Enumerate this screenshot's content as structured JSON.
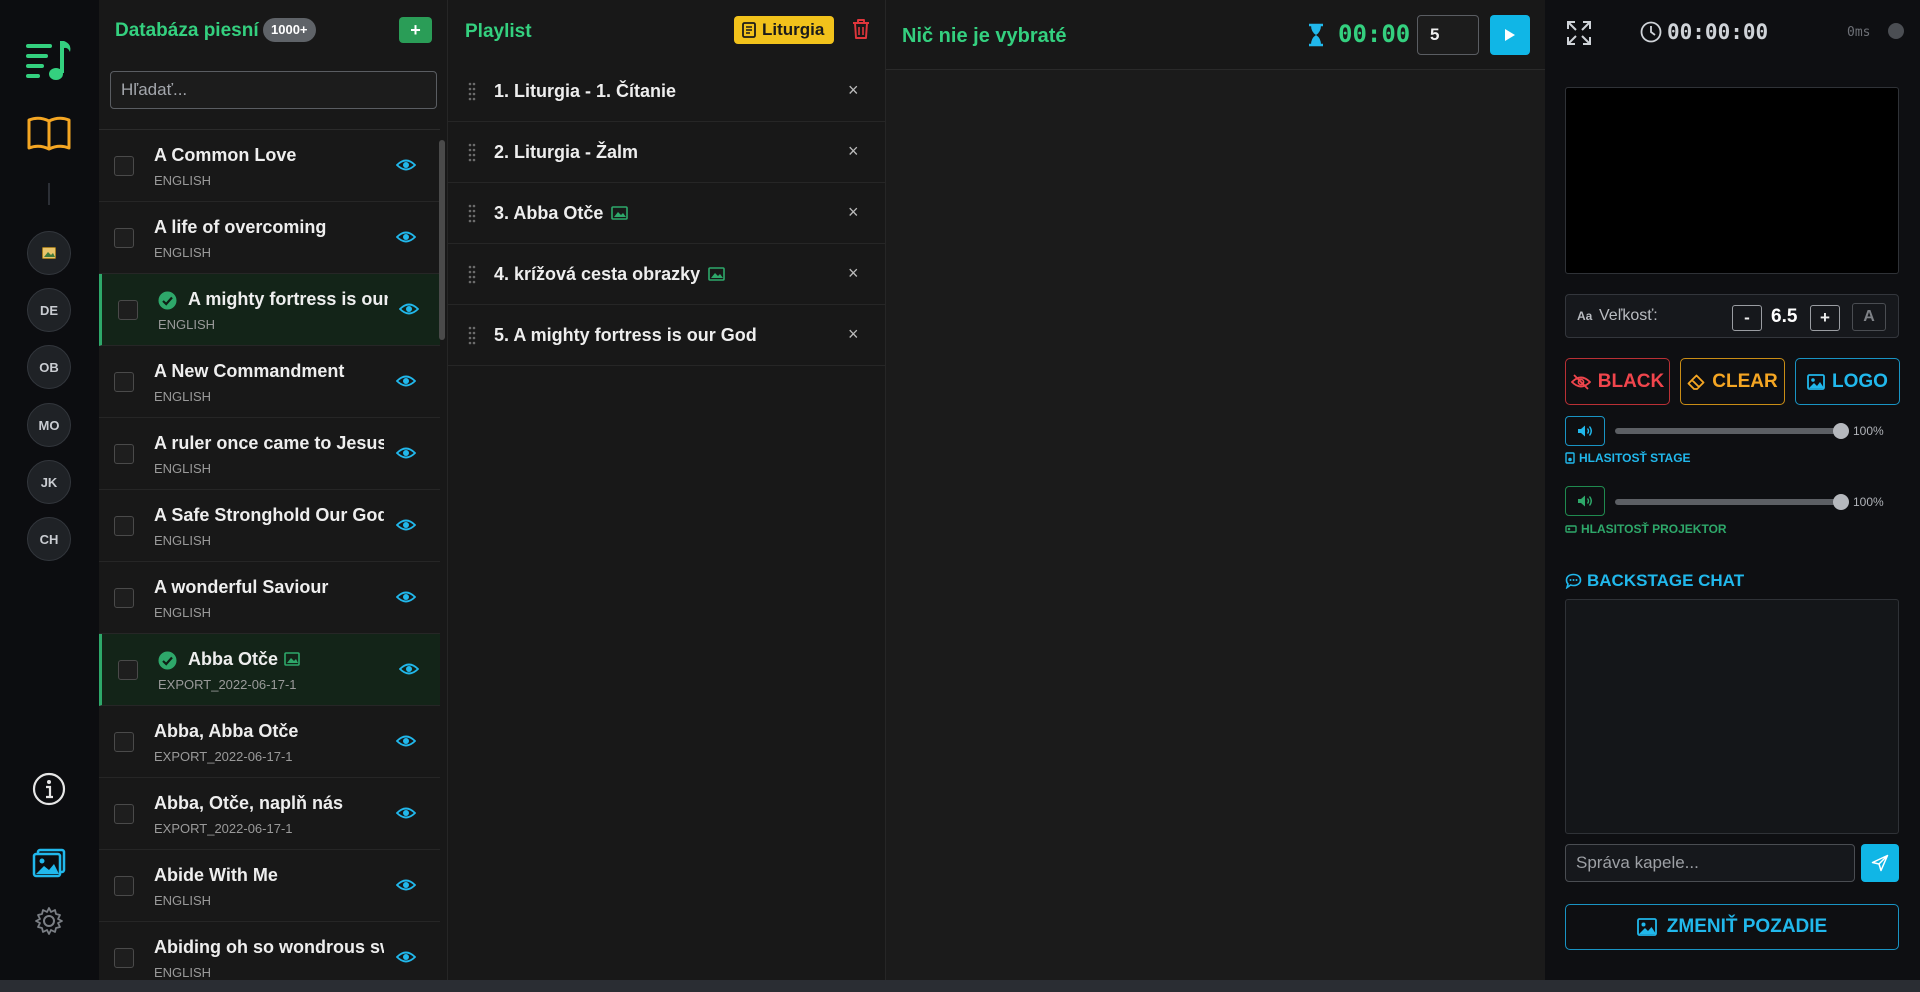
{
  "rail": {
    "buttons": [
      "",
      "DE",
      "OB",
      "MO",
      "JK",
      "CH"
    ]
  },
  "database": {
    "title": "Databáza piesní",
    "count": "1000+",
    "add_label": "+",
    "search_placeholder": "Hľadať...",
    "songs": [
      {
        "name": "A Common Love",
        "sub": "ENGLISH"
      },
      {
        "name": "A life of overcoming",
        "sub": "ENGLISH"
      },
      {
        "name": "A mighty fortress is our God",
        "sub": "ENGLISH"
      },
      {
        "name": "A New Commandment",
        "sub": "ENGLISH"
      },
      {
        "name": "A ruler once came to Jesus",
        "sub": "ENGLISH"
      },
      {
        "name": "A Safe Stronghold Our God",
        "sub": "ENGLISH"
      },
      {
        "name": "A wonderful Saviour",
        "sub": "ENGLISH"
      },
      {
        "name": "Abba Otče",
        "sub": "EXPORT_2022-06-17-1"
      },
      {
        "name": "Abba, Abba Otče",
        "sub": "EXPORT_2022-06-17-1"
      },
      {
        "name": "Abba, Otče, naplň nás",
        "sub": "EXPORT_2022-06-17-1"
      },
      {
        "name": "Abide With Me",
        "sub": "ENGLISH"
      },
      {
        "name": "Abiding oh so wondrous sweet",
        "sub": "ENGLISH"
      }
    ]
  },
  "playlist": {
    "title": "Playlist",
    "badge": "Liturgia",
    "items": [
      "1. Liturgia - 1. Čítanie",
      "2. Liturgia - Žalm",
      "3. Abba Otče",
      "4. krížová cesta obrazky",
      "5. A mighty fortress is our God"
    ],
    "remove_label": "×"
  },
  "preview": {
    "title": "Nič nie je vybraté",
    "timer": "00:00",
    "count_value": "5"
  },
  "panel": {
    "clock": "00:00:00",
    "latency": "0ms",
    "size_icon": "Aa",
    "size_label": "Veľkosť:",
    "size_minus": "-",
    "size_value": "6.5",
    "size_plus": "+",
    "size_auto": "A",
    "black_label": "BLACK",
    "clear_label": "CLEAR",
    "logo_label": "LOGO",
    "stage_volume_pct": "100%",
    "stage_volume_label": "HLASITOSŤ STAGE",
    "projector_volume_pct": "100%",
    "projector_volume_label": "HLASITOSŤ PROJEKTOR",
    "chat_title": "BACKSTAGE CHAT",
    "chat_placeholder": "Správa kapele...",
    "background_label": "ZMENIŤ POZADIE"
  },
  "colors": {
    "accent_green": "#34d07f",
    "accent_cyan": "#21b8ec",
    "danger": "#f0454c",
    "warning": "#f5a623",
    "badge_yellow": "#f2c21b"
  }
}
